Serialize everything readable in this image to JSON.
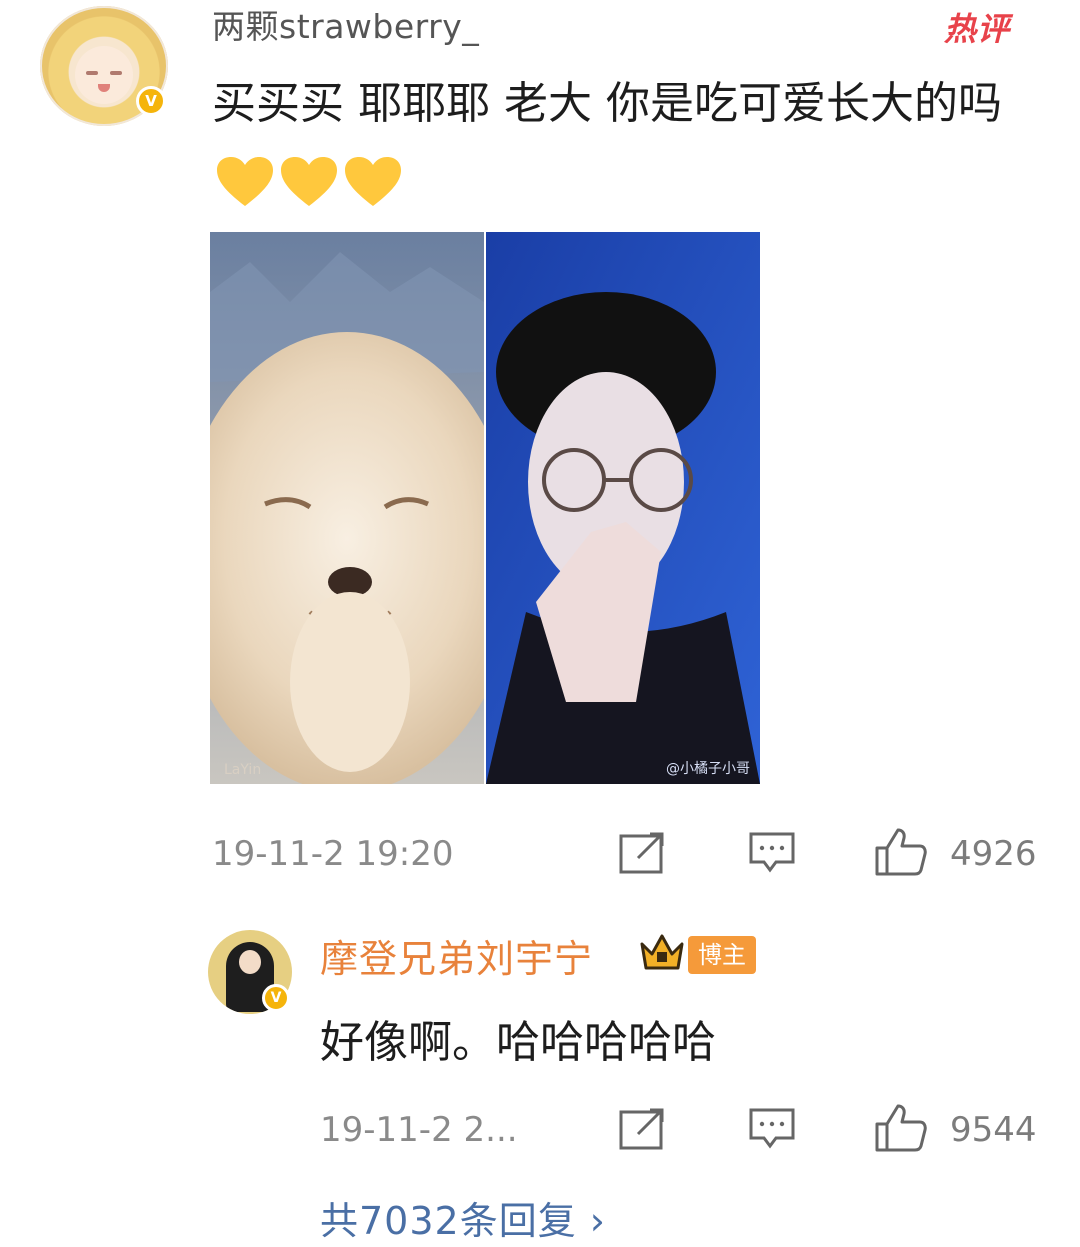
{
  "comment": {
    "username": "两颗strawberry_",
    "hot_label": "热评",
    "verified_icon": "v-badge-icon",
    "text": "买买买 耶耶耶 老大 你是吃可爱长大的吗",
    "hearts": [
      "yellow-heart-icon",
      "yellow-heart-icon",
      "yellow-heart-icon"
    ],
    "timestamp": "19-11-2 19:20",
    "like_count": "4926"
  },
  "reply": {
    "username": "摩登兄弟刘宇宁",
    "badge": "博主",
    "text": "好像啊。哈哈哈哈哈",
    "timestamp": "19-11-2 2...",
    "like_count": "9544"
  },
  "images": {
    "right_watermark": "@小橘子小哥",
    "left_watermark": "LaYin"
  },
  "footer": {
    "view_replies": "共7032条回复 ›"
  },
  "colors": {
    "hot": "#e8424a",
    "username_orange": "#e8823b",
    "link_blue": "#4a6fa5",
    "verified_gold": "#f5b40b"
  }
}
